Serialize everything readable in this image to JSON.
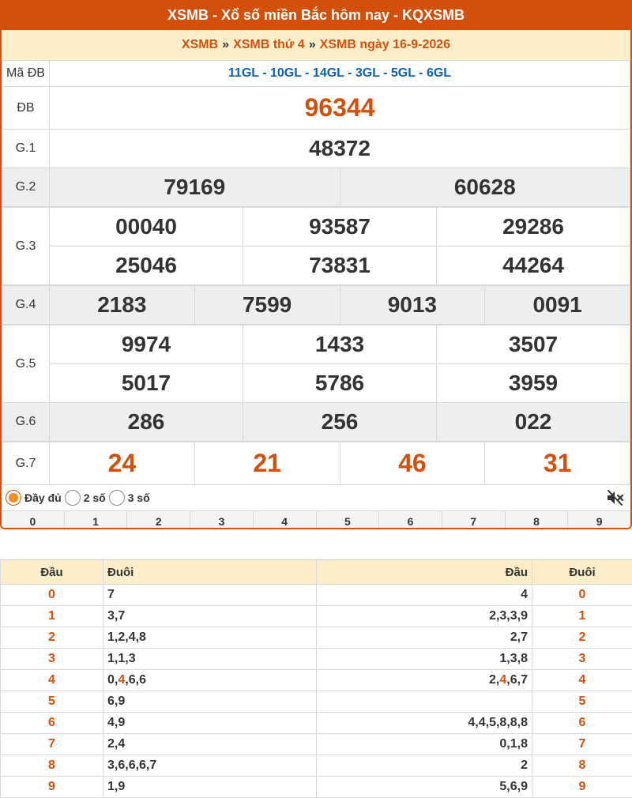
{
  "header": {
    "title": "XSMB - Xổ số miền Bắc hôm nay - KQXSMB",
    "breadcrumb": [
      "XSMB",
      "XSMB thứ 4",
      "XSMB ngày 16-9-2026"
    ],
    "separator": "»"
  },
  "results": {
    "ma_db_label": "Mã ĐB",
    "ma_db_value": "11GL - 10GL - 14GL - 3GL - 5GL - 6GL",
    "db": {
      "label": "ĐB",
      "value": "96344"
    },
    "g1": {
      "label": "G.1",
      "values": [
        "48372"
      ]
    },
    "g2": {
      "label": "G.2",
      "values": [
        "79169",
        "60628"
      ]
    },
    "g3": {
      "label": "G.3",
      "values": [
        "00040",
        "93587",
        "29286",
        "25046",
        "73831",
        "44264"
      ]
    },
    "g4": {
      "label": "G.4",
      "values": [
        "2183",
        "7599",
        "9013",
        "0091"
      ]
    },
    "g5": {
      "label": "G.5",
      "values": [
        "9974",
        "1433",
        "3507",
        "5017",
        "5786",
        "3959"
      ]
    },
    "g6": {
      "label": "G.6",
      "values": [
        "286",
        "256",
        "022"
      ]
    },
    "g7": {
      "label": "G.7",
      "values": [
        "24",
        "21",
        "46",
        "31"
      ]
    }
  },
  "controls": {
    "options": [
      "Đầy đủ",
      "2 số",
      "3 số"
    ],
    "selected": "Đầy đủ",
    "mute_icon": "volume-mute-icon",
    "digits": [
      "0",
      "1",
      "2",
      "3",
      "4",
      "5",
      "6",
      "7",
      "8",
      "9"
    ]
  },
  "loto": {
    "headers": [
      "Đầu",
      "Đuôi",
      "Đầu",
      "Đuôi"
    ],
    "rows": [
      {
        "dau": "0",
        "duoi": "7",
        "dau2": "4",
        "duoi2": "0"
      },
      {
        "dau": "1",
        "duoi": "3,7",
        "dau2": "2,3,3,9",
        "duoi2": "1"
      },
      {
        "dau": "2",
        "duoi": "1,2,4,8",
        "dau2": "2,7",
        "duoi2": "2"
      },
      {
        "dau": "3",
        "duoi": "1,1,3",
        "dau2": "1,3,8",
        "duoi2": "3"
      },
      {
        "dau": "4",
        "duoi": "0,4,6,6",
        "dau2": "2,4,6,7",
        "duoi2": "4"
      },
      {
        "dau": "5",
        "duoi": "6,9",
        "dau2": "",
        "duoi2": "5"
      },
      {
        "dau": "6",
        "duoi": "4,9",
        "dau2": "4,4,5,8,8,8",
        "duoi2": "6"
      },
      {
        "dau": "7",
        "duoi": "2,4",
        "dau2": "0,1,8",
        "duoi2": "7"
      },
      {
        "dau": "8",
        "duoi": "3,6,6,6,7",
        "dau2": "2",
        "duoi2": "8"
      },
      {
        "dau": "9",
        "duoi": "1,9",
        "dau2": "5,6,9",
        "duoi2": "9"
      }
    ],
    "highlight_row": 4,
    "highlight_value": "4"
  },
  "colors": {
    "accent": "#d44f09",
    "header_bg": "#fbeec9",
    "code_blue": "#0a61b4"
  }
}
